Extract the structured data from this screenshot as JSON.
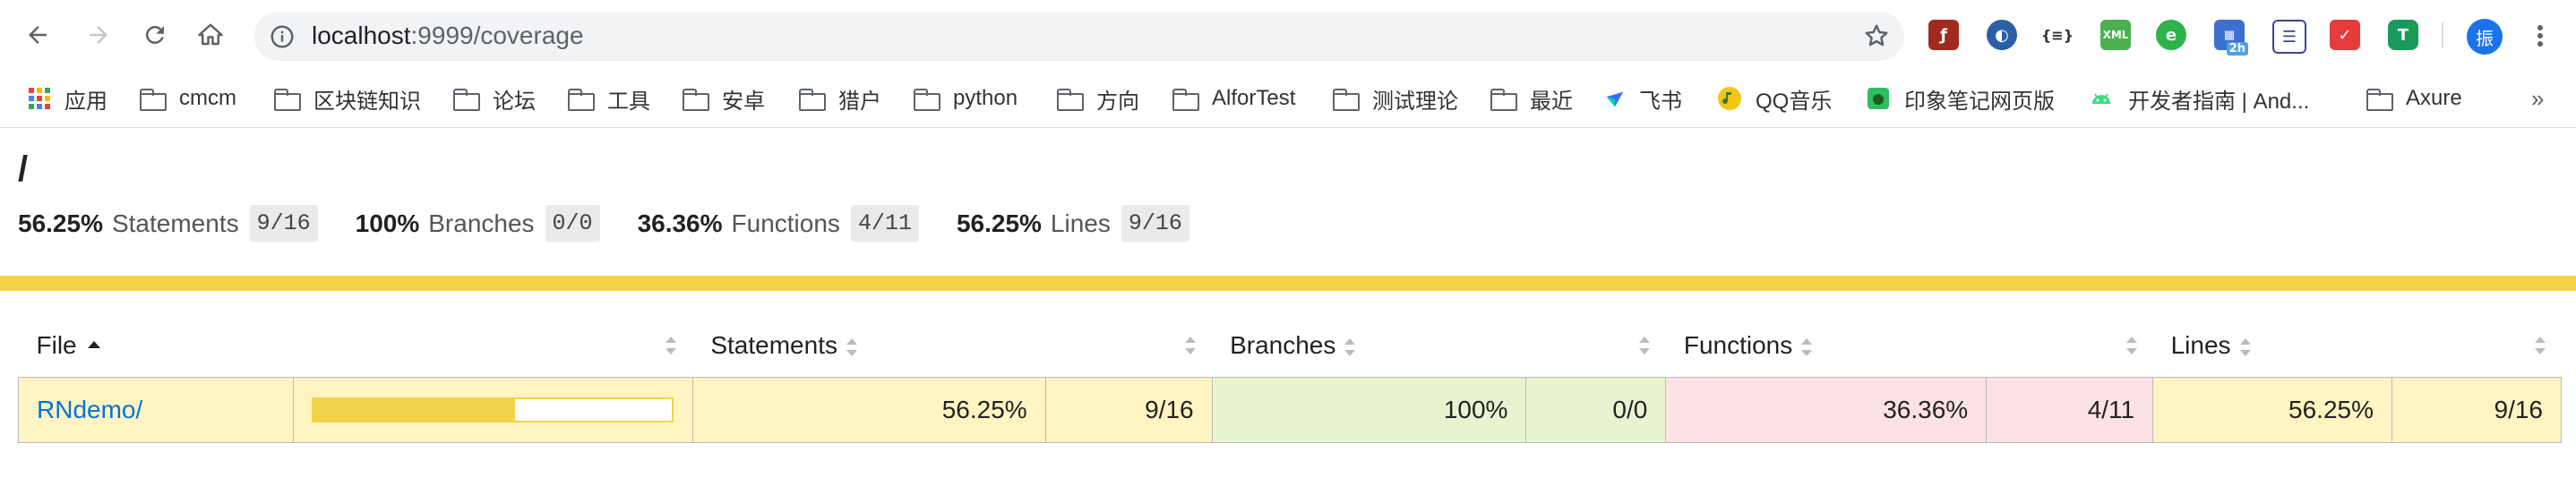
{
  "browser": {
    "url_host": "localhost",
    "url_rest": ":9999/coverage",
    "profile_initial": "振",
    "extension_badge": "2h"
  },
  "bookmarks": [
    {
      "label": "应用",
      "icon": "apps-grid-icon"
    },
    {
      "label": "cmcm",
      "icon": "folder-icon"
    },
    {
      "label": "区块链知识",
      "icon": "folder-icon"
    },
    {
      "label": "论坛",
      "icon": "folder-icon"
    },
    {
      "label": "工具",
      "icon": "folder-icon"
    },
    {
      "label": "安卓",
      "icon": "folder-icon"
    },
    {
      "label": "猎户",
      "icon": "folder-icon"
    },
    {
      "label": "python",
      "icon": "folder-icon"
    },
    {
      "label": "方向",
      "icon": "folder-icon"
    },
    {
      "label": "AlforTest",
      "icon": "folder-icon"
    },
    {
      "label": "测试理论",
      "icon": "folder-icon"
    },
    {
      "label": "最近",
      "icon": "folder-icon"
    },
    {
      "label": "飞书",
      "icon": "feishu-icon"
    },
    {
      "label": "QQ音乐",
      "icon": "qq-music-icon"
    },
    {
      "label": "印象笔记网页版",
      "icon": "evernote-icon"
    },
    {
      "label": "开发者指南 | And...",
      "icon": "android-icon"
    },
    {
      "label": "Axure",
      "icon": "folder-icon"
    }
  ],
  "page": {
    "breadcrumb": "/",
    "summary": [
      {
        "pct": "56.25%",
        "label": "Statements",
        "fraction": "9/16"
      },
      {
        "pct": "100%",
        "label": "Branches",
        "fraction": "0/0"
      },
      {
        "pct": "36.36%",
        "label": "Functions",
        "fraction": "4/11"
      },
      {
        "pct": "56.25%",
        "label": "Lines",
        "fraction": "9/16"
      }
    ],
    "status_color": "#f4d348",
    "table": {
      "headers": {
        "file": "File",
        "statements": "Statements",
        "branches": "Branches",
        "functions": "Functions",
        "lines": "Lines"
      },
      "rows": [
        {
          "file": "RNdemo/",
          "coverage_fraction": 0.5625,
          "statements_pct": "56.25%",
          "statements_frac": "9/16",
          "branches_pct": "100%",
          "branches_frac": "0/0",
          "functions_pct": "36.36%",
          "functions_frac": "4/11",
          "lines_pct": "56.25%",
          "lines_frac": "9/16"
        }
      ]
    }
  },
  "colors": {
    "medium": "#fff4c2",
    "high": "#e6f5d0",
    "low": "#fce1e5",
    "link": "#0074d9"
  }
}
